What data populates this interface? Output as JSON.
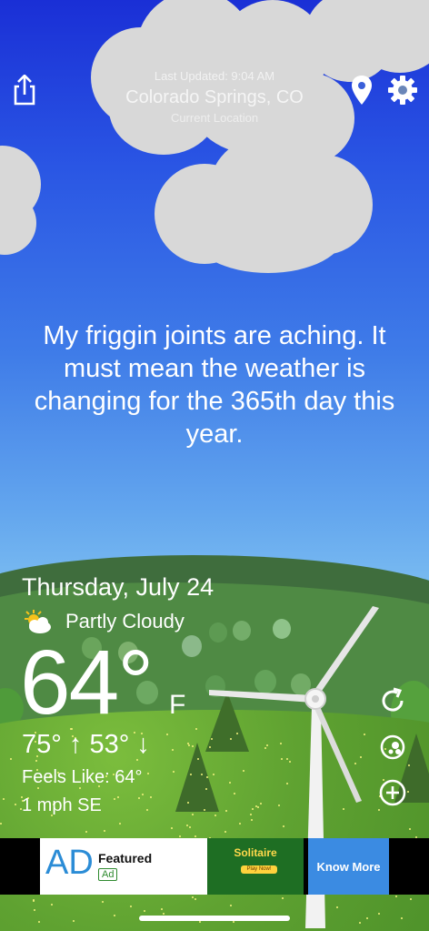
{
  "header": {
    "last_updated": "Last Updated: 9:04 AM",
    "city": "Colorado Springs, CO",
    "location_label": "Current Location"
  },
  "quote": "My friggin joints are aching. It must mean the weather is changing for the 365th day this year.",
  "weather": {
    "date": "Thursday, July 24",
    "condition": "Partly Cloudy",
    "condition_icon": "partly-cloudy-icon",
    "temperature": "64°",
    "unit": "F",
    "high_low": "75° ↑  53° ↓",
    "feels_like": "Feels Like: 64°",
    "wind": "1 mph SE"
  },
  "icons": {
    "share": "share-icon",
    "location": "location-pin-icon",
    "settings": "gear-icon",
    "refresh": "refresh-icon",
    "radar": "radar-icon",
    "add": "add-icon"
  },
  "ad": {
    "logo": "AD",
    "title": "Featured",
    "badge": "Ad",
    "promo_title": "Solitaire",
    "promo_button": "Play Now!",
    "cta": "Know More"
  },
  "colors": {
    "sky_top": "#1a2fd6",
    "sky_bottom": "#9dd3f5",
    "grass": "#5fa231",
    "cta": "#3b8be2"
  }
}
